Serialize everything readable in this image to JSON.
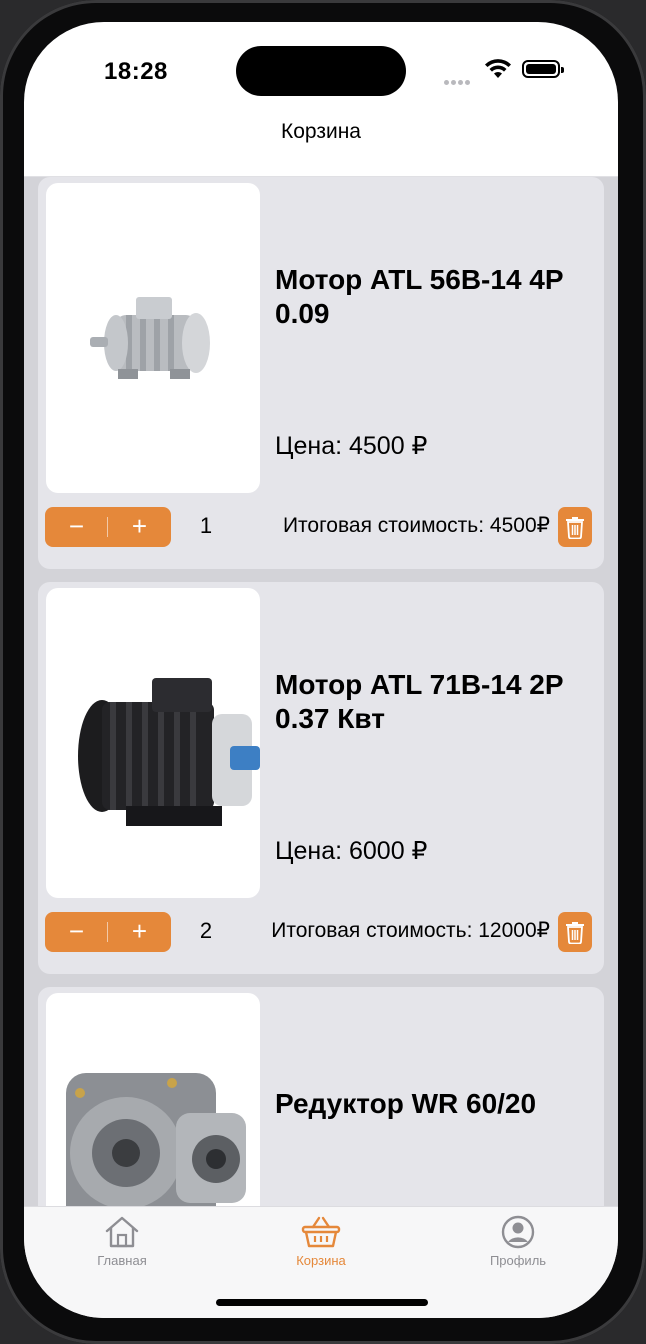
{
  "status": {
    "time": "18:28"
  },
  "header": {
    "title": "Корзина"
  },
  "cart": {
    "items": [
      {
        "name": "Мотор ATL 56B-14 4P 0.09",
        "price": "Цена: 4500 ₽",
        "quantity": "1",
        "total": "Итоговая стоимость: 4500₽",
        "image": "electric-motor-gray"
      },
      {
        "name": "Мотор ATL 71B-14 2P 0.37 Квт",
        "price": "Цена: 6000 ₽",
        "quantity": "2",
        "total": "Итоговая стоимость: 12000₽",
        "image": "electric-motor-black"
      },
      {
        "name": "Редуктор WR 60/20",
        "image": "worm-gear-reducer"
      }
    ],
    "stepper": {
      "minus": "−",
      "plus": "+"
    }
  },
  "tabbar": {
    "items": [
      {
        "label": "Главная",
        "icon": "home-icon",
        "active": false
      },
      {
        "label": "Корзина",
        "icon": "basket-icon",
        "active": true
      },
      {
        "label": "Профиль",
        "icon": "profile-icon",
        "active": false
      }
    ]
  },
  "colors": {
    "accent": "#e5883a",
    "card": "#e5e5ea",
    "list_bg": "#d3d3d8",
    "tab_inactive": "#8e8e93"
  }
}
